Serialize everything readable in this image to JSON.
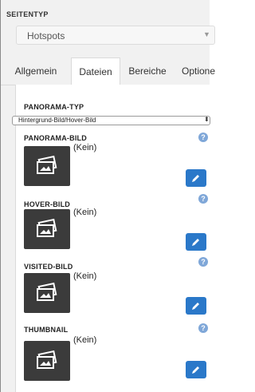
{
  "page_type": {
    "label": "SEITENTYP",
    "selected": "Hotspots"
  },
  "tabs": [
    {
      "label": "Allgemein",
      "active": false
    },
    {
      "label": "Dateien",
      "active": true
    },
    {
      "label": "Bereiche",
      "active": false
    },
    {
      "label": "Optione",
      "active": false
    }
  ],
  "panorama_type": {
    "label": "PANORAMA-TYP",
    "selected": "Hintergrund-Bild/Hover-Bild",
    "arrows": "⬍"
  },
  "images": [
    {
      "label": "PANORAMA-BILD",
      "value": "(Kein)"
    },
    {
      "label": "HOVER-BILD",
      "value": "(Kein)"
    },
    {
      "label": "VISITED-BILD",
      "value": "(Kein)"
    },
    {
      "label": "THUMBNAIL",
      "value": "(Kein)"
    }
  ],
  "icons": {
    "help": "question-circle-icon",
    "image": "image-placeholder-icon",
    "edit": "pencil-icon"
  },
  "colors": {
    "edit_button": "#2a78c9",
    "help_icon": "#7fa7d8",
    "thumbnail_bg": "#3b3b3b"
  }
}
